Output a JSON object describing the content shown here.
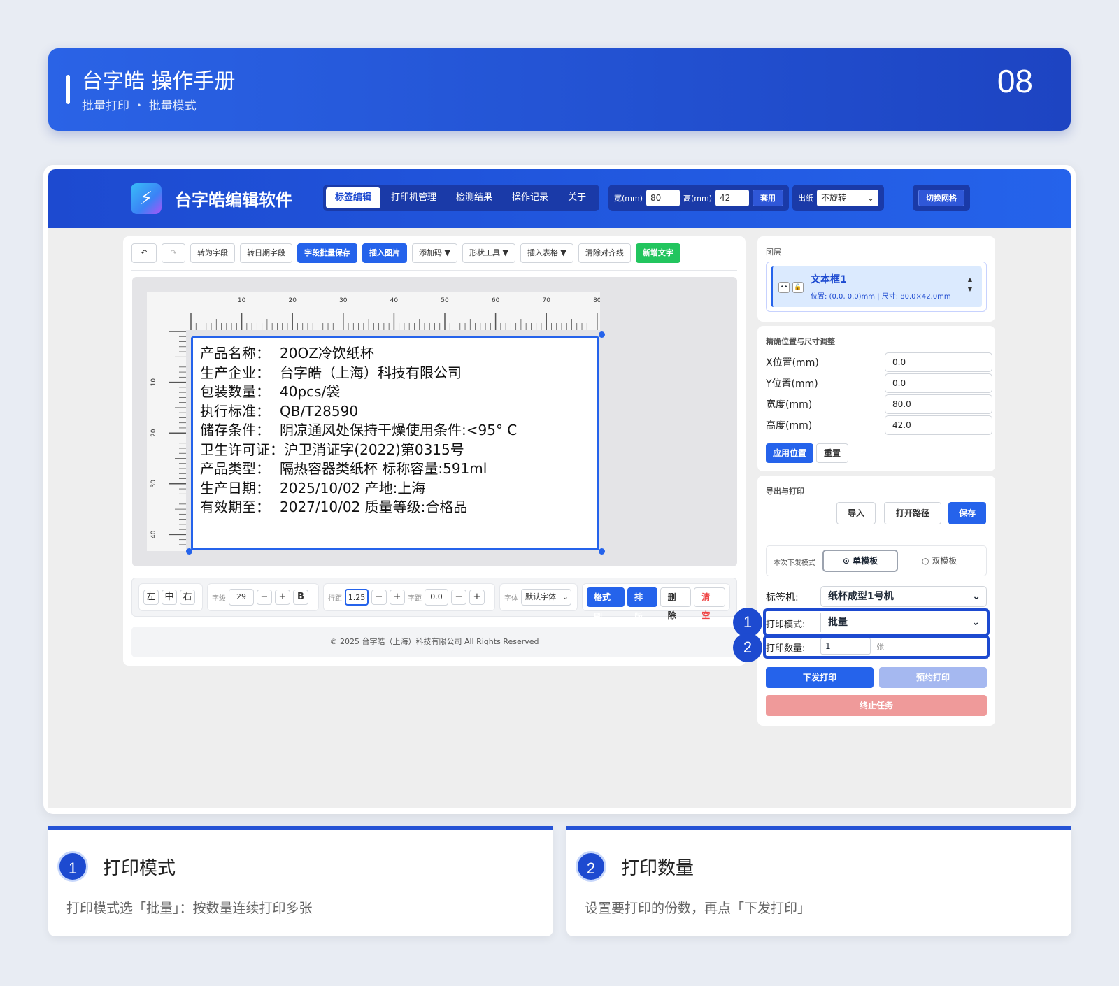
{
  "header": {
    "title": "台字皓 操作手册",
    "subtitle": "批量打印 ・ 批量模式",
    "page": "08"
  },
  "app": {
    "name": "台字皓编辑软件",
    "logo_icon": "lightning-icon",
    "tabs": [
      "标签编辑",
      "打印机管理",
      "检测结果",
      "操作记录",
      "关于"
    ],
    "width_label": "宽(mm)",
    "width": "80",
    "height_label": "高(mm)",
    "height": "42",
    "apply": "套用",
    "out_label": "出纸",
    "out_value": "不旋转",
    "grid_btn": "切换网格"
  },
  "toolbar": {
    "undo_icon": "undo-icon",
    "redo_icon": "redo-icon",
    "to_field": "转为字段",
    "to_date": "转日期字段",
    "batch_save": "字段批量保存",
    "insert_img": "插入图片",
    "add_code": "添加码 ▼",
    "shape": "形状工具 ▼",
    "table": "插入表格 ▼",
    "clear_guides": "清除对齐线",
    "new_text": "新增文字"
  },
  "ruler": {
    "h": [
      "10",
      "20",
      "30",
      "40",
      "50",
      "60",
      "70",
      "80"
    ],
    "v": [
      "10",
      "20",
      "30",
      "40"
    ]
  },
  "label": {
    "lines": [
      {
        "k": "产品名称：",
        "v": "20OZ冷饮纸杯"
      },
      {
        "k": "生产企业：",
        "v": "台字皓（上海）科技有限公司"
      },
      {
        "k": "包装数量：",
        "v": "40pcs/袋"
      },
      {
        "k": "执行标准：",
        "v": "QB/T28590"
      },
      {
        "k": "储存条件：",
        "v": "阴凉通风处保持干燥使用条件:<95° C"
      },
      {
        "k": "卫生许可证：",
        "v": " 沪卫消证字(2022)第0315号"
      },
      {
        "k": "产品类型：",
        "v": "隔热容器类纸杯 标称容量:591ml"
      },
      {
        "k": "生产日期：",
        "v": "2025/10/02 产地:上海"
      },
      {
        "k": "有效期至：",
        "v": "2027/10/02 质量等级:合格品"
      }
    ]
  },
  "bottom": {
    "left": "左",
    "center": "中",
    "right": "右",
    "size_label": "字级",
    "size": "29",
    "minus": "−",
    "plus": "+",
    "bold": "B",
    "lh_label": "行距",
    "lh": "1.25",
    "ls_label": "字距",
    "ls": "0.0",
    "font_label": "字体",
    "font": "默认字体",
    "fmt": "格式刷",
    "layout": "排版",
    "delete": "删除",
    "clear": "清空"
  },
  "footer": "© 2025 台字皓（上海）科技有限公司 All Rights Reserved",
  "layers": {
    "title": "图层",
    "name": "文本框1",
    "info": "位置: (0.0, 0.0)mm | 尺寸: 80.0×42.0mm",
    "eye_icon": "eye-icon",
    "lock_icon": "lock-icon",
    "up": "▲",
    "down": "▼"
  },
  "position": {
    "title": "精确位置与尺寸调整",
    "x_label": "X位置(mm)",
    "x": "0.0",
    "y_label": "Y位置(mm)",
    "y": "0.0",
    "w_label": "宽度(mm)",
    "w": "80.0",
    "h_label": "高度(mm)",
    "h": "42.0",
    "apply": "应用位置",
    "reset": "重置"
  },
  "export": {
    "title": "导出与打印",
    "import": "导入",
    "open": "打开路径",
    "save": "保存",
    "mode_label": "本次下发模式",
    "single": "单模板",
    "double": "双模板",
    "printer_label": "标签机:",
    "printer": "纸杯成型1号机",
    "print_mode_label": "打印模式:",
    "print_mode": "批量",
    "qty_label": "打印数量:",
    "qty": "1",
    "qty_unit": "张",
    "send": "下发打印",
    "schedule": "预约打印",
    "stop": "终止任务"
  },
  "badges": [
    "1",
    "2"
  ],
  "cards": [
    {
      "num": "1",
      "title": "打印模式",
      "desc": "打印模式选「批量」：按数量连续打印多张"
    },
    {
      "num": "2",
      "title": "打印数量",
      "desc": "设置要打印的份数，再点「下发打印」"
    }
  ],
  "colors": {
    "primary": "#2563eb",
    "header": "#1d44c2",
    "green": "#22c55e",
    "stop": "#ef9a9a"
  }
}
